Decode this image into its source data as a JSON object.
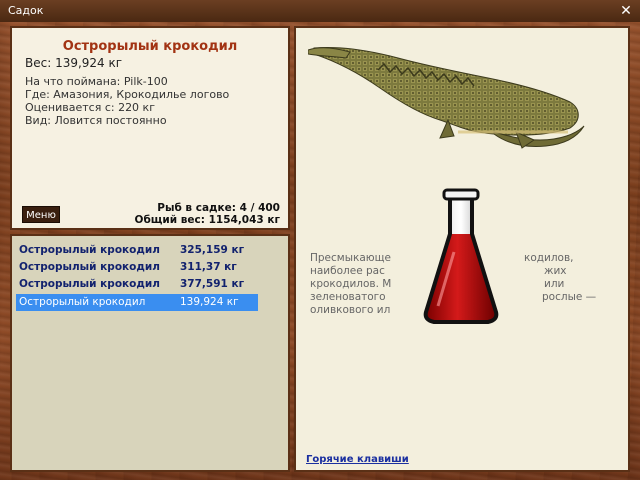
{
  "window": {
    "title": "Садок",
    "close_icon": "close-icon"
  },
  "fish": {
    "name": "Острорылый крокодил",
    "weight": "Вес: 139,924 кг",
    "caught_with": "На что поймана: Pilk-100",
    "location": "Где: Амазония, Крокодилье логово",
    "valued_from": "Оценивается с: 220 кг",
    "kind": "Вид: Ловится постоянно"
  },
  "keepnet": {
    "count": "Рыб в садке: 4 / 400",
    "total_weight": "Общий вес: 1154,043 кг"
  },
  "menu_button": "Меню",
  "catch_list": [
    {
      "name": "Острорылый крокодил",
      "weight": "325,159 кг",
      "selected": false
    },
    {
      "name": "Острорылый крокодил",
      "weight": "311,37 кг",
      "selected": false
    },
    {
      "name": "Острорылый крокодил",
      "weight": "377,591 кг",
      "selected": false
    },
    {
      "name": "Острорылый крокодил",
      "weight": "139,924 кг",
      "selected": true
    }
  ],
  "description": {
    "line1a": "Пресмыкающе",
    "line1b": "кодилов,",
    "line2a": "наиболее рас",
    "line2b": "жих",
    "line3a": "крокодилов. М",
    "line3b": "или",
    "line4a": "зеленоватого",
    "line4b": "рослые —",
    "line5a": "оливкового ил"
  },
  "hotkeys_link": "Горячие клавиши",
  "colors": {
    "title_red": "#a23313",
    "list_text": "#12226e",
    "selection": "#3a8ef0",
    "link": "#1a2fa0"
  }
}
